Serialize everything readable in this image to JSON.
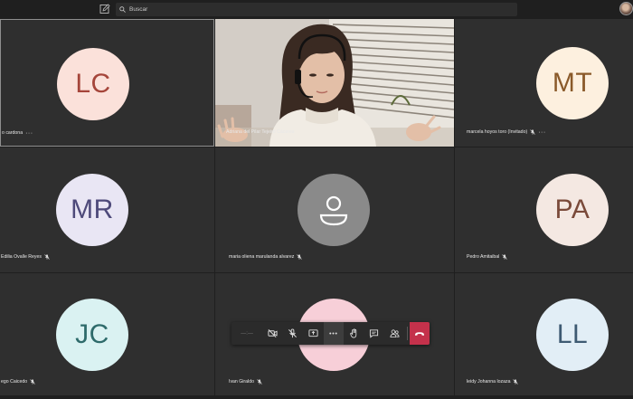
{
  "search": {
    "placeholder": "Buscar"
  },
  "participants": [
    {
      "initials": "LC",
      "name": "o cardona",
      "bg": "#fbe1da",
      "fg": "#a5453a"
    },
    {
      "initials": "",
      "name": "Adriana del Pilar Tejeiro Cáceres"
    },
    {
      "initials": "MT",
      "name": "marcela hoyos toro (Invitado)",
      "bg": "#fdf0df",
      "fg": "#8a5a2a"
    },
    {
      "initials": "MR",
      "name": "Edilia Ovalle Reyes",
      "bg": "#e9e6f4",
      "fg": "#4e4a7a"
    },
    {
      "initials": "",
      "name": "maria oliena marulanda alvarez",
      "bg": "#8a8a8a"
    },
    {
      "initials": "PA",
      "name": "Pedro Amitaibal",
      "bg": "#f4e8e2",
      "fg": "#7a4a3a"
    },
    {
      "initials": "JC",
      "name": "ego Caicedo",
      "bg": "#daf2f2",
      "fg": "#2e6b6b"
    },
    {
      "initials": "",
      "name": "Ivan Giraldo",
      "bg": "#f7cfd8"
    },
    {
      "initials": "LL",
      "name": "leidy Johanna lozaza",
      "bg": "#e2eef6",
      "fg": "#3e5a72"
    }
  ],
  "toolbar": {
    "time": "—:—"
  },
  "colors": {
    "hangup": "#c4314b",
    "tile": "#2f2f2f"
  }
}
